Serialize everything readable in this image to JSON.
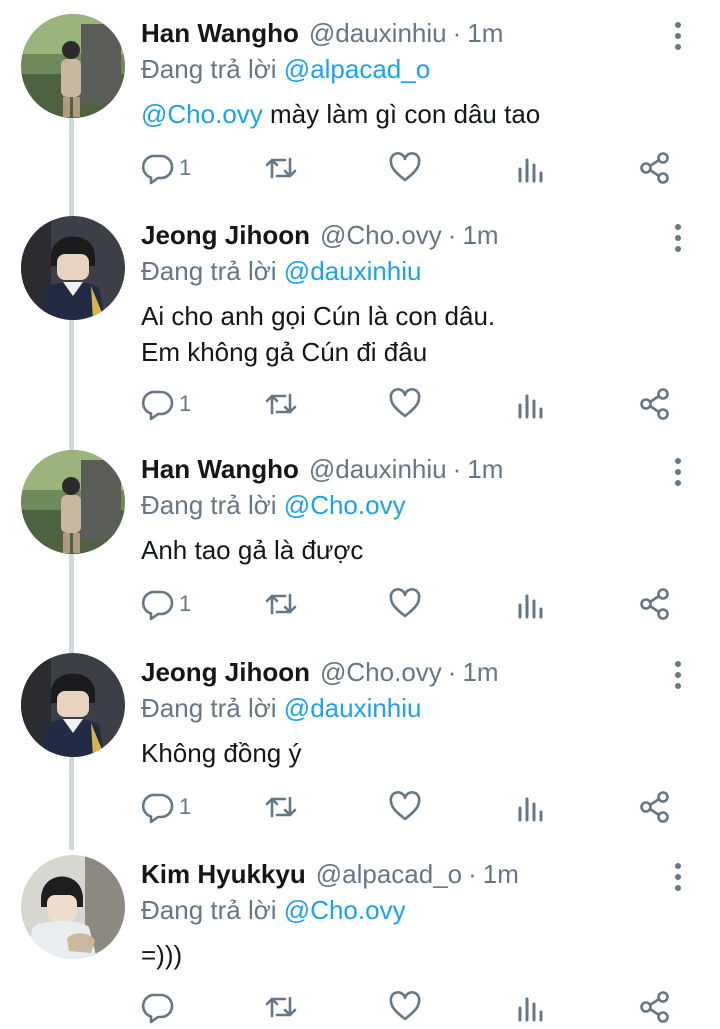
{
  "colors": {
    "link": "#1da1f2",
    "muted": "#657786",
    "text": "#14171a",
    "thread": "#cfd9de"
  },
  "tweets": [
    {
      "name": "Han Wangho",
      "handle": "@dauxinhiu",
      "sep": "·",
      "time": "1m",
      "reply_prefix": "Đang trả lời",
      "reply_to": "@alpacad_o",
      "text_mention": "@Cho.ovy",
      "text": " mày làm gì con dâu tao",
      "reply_count": "1"
    },
    {
      "name": "Jeong Jihoon",
      "handle": "@Cho.ovy",
      "sep": "·",
      "time": "1m",
      "reply_prefix": "Đang trả lời",
      "reply_to": "@dauxinhiu",
      "text_mention": "",
      "text": "Ai cho anh gọi Cún là con dâu.\nEm không gả Cún đi đâu",
      "reply_count": "1"
    },
    {
      "name": "Han Wangho",
      "handle": "@dauxinhiu",
      "sep": "·",
      "time": "1m",
      "reply_prefix": "Đang trả lời",
      "reply_to": "@Cho.ovy",
      "text_mention": "",
      "text": "Anh tao gả là được",
      "reply_count": "1"
    },
    {
      "name": "Jeong Jihoon",
      "handle": "@Cho.ovy",
      "sep": "·",
      "time": "1m",
      "reply_prefix": "Đang trả lời",
      "reply_to": "@dauxinhiu",
      "text_mention": "",
      "text": "Không đồng ý",
      "reply_count": "1"
    },
    {
      "name": "Kim Hyukkyu",
      "handle": "@alpacad_o",
      "sep": "·",
      "time": "1m",
      "reply_prefix": "Đang trả lời",
      "reply_to": "@Cho.ovy",
      "text_mention": "",
      "text": "=)))",
      "reply_count": ""
    }
  ],
  "icons": {
    "reply": "reply-icon",
    "retweet": "retweet-icon",
    "like": "heart-icon",
    "stats": "stats-icon",
    "share": "share-icon",
    "more": "more-vertical-icon"
  }
}
